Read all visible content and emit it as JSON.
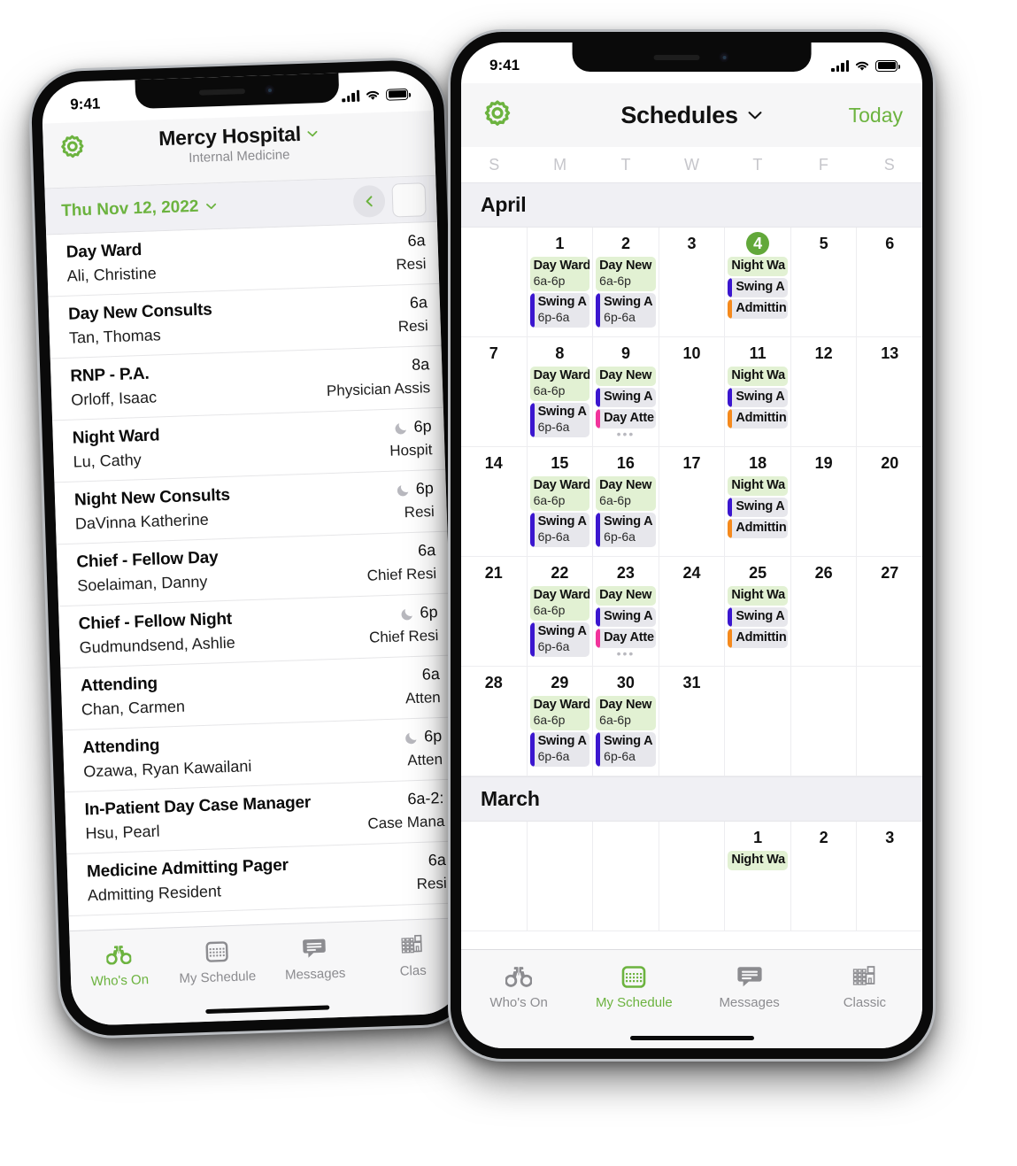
{
  "colors": {
    "accent_green": "#6cb33f",
    "today_badge": "#62a83a",
    "chip_green_bg": "#e2f1d3",
    "chip_grey_bg": "#e7e7ec",
    "bar_indigo": "#3b16cf",
    "bar_orange": "#f58a1d",
    "bar_pink": "#f2339b"
  },
  "phone_left": {
    "status": {
      "time": "9:41",
      "signal_icon": "cellular-bars-icon",
      "wifi_icon": "wifi-icon",
      "battery_icon": "battery-icon"
    },
    "nav": {
      "gear_icon": "gear-icon",
      "title": "Mercy Hospital",
      "title_chevron_icon": "chevron-down-icon",
      "subtitle": "Internal Medicine"
    },
    "datebar": {
      "date": "Thu Nov 12, 2022",
      "chevron_icon": "chevron-down-icon",
      "prev_icon": "chevron-left-icon"
    },
    "rows": [
      {
        "assignment": "Day Ward",
        "person": "Ali, Christine",
        "time": "6a",
        "role": "Resi",
        "night": false
      },
      {
        "assignment": "Day New Consults",
        "person": "Tan, Thomas",
        "time": "6a",
        "role": "Resi",
        "night": false
      },
      {
        "assignment": "RNP - P.A.",
        "person": "Orloff, Isaac",
        "time": "8a",
        "role": "Physician Assis",
        "night": false
      },
      {
        "assignment": "Night Ward",
        "person": "Lu, Cathy",
        "time": "6p",
        "role": "Hospit",
        "night": true
      },
      {
        "assignment": "Night New Consults",
        "person": "DaVinna Katherine",
        "time": "6p",
        "role": "Resi",
        "night": true
      },
      {
        "assignment": "Chief - Fellow Day",
        "person": "Soelaiman, Danny",
        "time": "6a",
        "role": "Chief Resi",
        "night": false
      },
      {
        "assignment": "Chief - Fellow Night",
        "person": "Gudmundsend, Ashlie",
        "time": "6p",
        "role": "Chief Resi",
        "night": true
      },
      {
        "assignment": "Attending",
        "person": "Chan, Carmen",
        "time": "6a",
        "role": "Atten",
        "night": false
      },
      {
        "assignment": "Attending",
        "person": "Ozawa, Ryan Kawailani",
        "time": "6p",
        "role": "Atten",
        "night": true
      },
      {
        "assignment": "In-Patient Day Case Manager",
        "person": "Hsu, Pearl",
        "time": "6a-2:",
        "role": "Case Mana",
        "night": false
      },
      {
        "assignment": "Medicine Admitting Pager",
        "person": "Admitting Resident",
        "time": "6a",
        "role": "Resi",
        "night": false
      }
    ],
    "tabs": [
      {
        "label": "Who's On",
        "icon": "binoculars-icon",
        "active": true
      },
      {
        "label": "My Schedule",
        "icon": "calendar-icon",
        "active": false
      },
      {
        "label": "Messages",
        "icon": "message-icon",
        "active": false
      },
      {
        "label": "Clas",
        "icon": "classic-grid-icon",
        "active": false
      }
    ]
  },
  "phone_right": {
    "status": {
      "time": "9:41",
      "signal_icon": "cellular-bars-icon",
      "wifi_icon": "wifi-icon",
      "battery_icon": "battery-icon"
    },
    "nav": {
      "gear_icon": "gear-icon",
      "title": "Schedules",
      "title_chevron_icon": "chevron-down-icon",
      "today_label": "Today"
    },
    "weekday_headers": [
      "S",
      "M",
      "T",
      "W",
      "T",
      "F",
      "S"
    ],
    "months": [
      {
        "name": "April",
        "weeks": [
          [
            {
              "day": ""
            },
            {
              "day": "1",
              "chips": [
                {
                  "title": "Day Ward",
                  "time": "6a-6p",
                  "style": "green"
                },
                {
                  "title": "Swing A",
                  "time": "6p-6a",
                  "style": "grey",
                  "bar": "#3b16cf"
                }
              ]
            },
            {
              "day": "2",
              "chips": [
                {
                  "title": "Day New",
                  "time": "6a-6p",
                  "style": "green"
                },
                {
                  "title": "Swing A",
                  "time": "6p-6a",
                  "style": "grey",
                  "bar": "#3b16cf"
                }
              ]
            },
            {
              "day": "3"
            },
            {
              "day": "4",
              "today": true,
              "chips": [
                {
                  "title": "Night Wa",
                  "time": "",
                  "style": "green"
                },
                {
                  "title": "Swing A",
                  "time": "",
                  "style": "grey",
                  "bar": "#3b16cf"
                },
                {
                  "title": "Admittin",
                  "time": "",
                  "style": "grey",
                  "bar": "#f58a1d"
                }
              ]
            },
            {
              "day": "5"
            },
            {
              "day": "6"
            }
          ],
          [
            {
              "day": "7"
            },
            {
              "day": "8",
              "chips": [
                {
                  "title": "Day Ward",
                  "time": "6a-6p",
                  "style": "green"
                },
                {
                  "title": "Swing A",
                  "time": "6p-6a",
                  "style": "grey",
                  "bar": "#3b16cf"
                }
              ]
            },
            {
              "day": "9",
              "overflow": true,
              "chips": [
                {
                  "title": "Day New",
                  "time": "",
                  "style": "green"
                },
                {
                  "title": "Swing A",
                  "time": "",
                  "style": "grey",
                  "bar": "#3b16cf"
                },
                {
                  "title": "Day Atte",
                  "time": "",
                  "style": "grey",
                  "bar": "#f2339b"
                }
              ]
            },
            {
              "day": "10"
            },
            {
              "day": "11",
              "chips": [
                {
                  "title": "Night Wa",
                  "time": "",
                  "style": "green"
                },
                {
                  "title": "Swing A",
                  "time": "",
                  "style": "grey",
                  "bar": "#3b16cf"
                },
                {
                  "title": "Admittin",
                  "time": "",
                  "style": "grey",
                  "bar": "#f58a1d"
                }
              ]
            },
            {
              "day": "12"
            },
            {
              "day": "13"
            }
          ],
          [
            {
              "day": "14"
            },
            {
              "day": "15",
              "chips": [
                {
                  "title": "Day Ward",
                  "time": "6a-6p",
                  "style": "green"
                },
                {
                  "title": "Swing A",
                  "time": "6p-6a",
                  "style": "grey",
                  "bar": "#3b16cf"
                }
              ]
            },
            {
              "day": "16",
              "chips": [
                {
                  "title": "Day New",
                  "time": "6a-6p",
                  "style": "green"
                },
                {
                  "title": "Swing A",
                  "time": "6p-6a",
                  "style": "grey",
                  "bar": "#3b16cf"
                }
              ]
            },
            {
              "day": "17"
            },
            {
              "day": "18",
              "chips": [
                {
                  "title": "Night Wa",
                  "time": "",
                  "style": "green"
                },
                {
                  "title": "Swing A",
                  "time": "",
                  "style": "grey",
                  "bar": "#3b16cf"
                },
                {
                  "title": "Admittin",
                  "time": "",
                  "style": "grey",
                  "bar": "#f58a1d"
                }
              ]
            },
            {
              "day": "19"
            },
            {
              "day": "20"
            }
          ],
          [
            {
              "day": "21"
            },
            {
              "day": "22",
              "chips": [
                {
                  "title": "Day Ward",
                  "time": "6a-6p",
                  "style": "green"
                },
                {
                  "title": "Swing A",
                  "time": "6p-6a",
                  "style": "grey",
                  "bar": "#3b16cf"
                }
              ]
            },
            {
              "day": "23",
              "overflow": true,
              "chips": [
                {
                  "title": "Day New",
                  "time": "",
                  "style": "green"
                },
                {
                  "title": "Swing A",
                  "time": "",
                  "style": "grey",
                  "bar": "#3b16cf"
                },
                {
                  "title": "Day Atte",
                  "time": "",
                  "style": "grey",
                  "bar": "#f2339b"
                }
              ]
            },
            {
              "day": "24"
            },
            {
              "day": "25",
              "chips": [
                {
                  "title": "Night Wa",
                  "time": "",
                  "style": "green"
                },
                {
                  "title": "Swing A",
                  "time": "",
                  "style": "grey",
                  "bar": "#3b16cf"
                },
                {
                  "title": "Admittin",
                  "time": "",
                  "style": "grey",
                  "bar": "#f58a1d"
                }
              ]
            },
            {
              "day": "26"
            },
            {
              "day": "27"
            }
          ],
          [
            {
              "day": "28"
            },
            {
              "day": "29",
              "chips": [
                {
                  "title": "Day Ward",
                  "time": "6a-6p",
                  "style": "green"
                },
                {
                  "title": "Swing A",
                  "time": "6p-6a",
                  "style": "grey",
                  "bar": "#3b16cf"
                }
              ]
            },
            {
              "day": "30",
              "chips": [
                {
                  "title": "Day New",
                  "time": "6a-6p",
                  "style": "green"
                },
                {
                  "title": "Swing A",
                  "time": "6p-6a",
                  "style": "grey",
                  "bar": "#3b16cf"
                }
              ]
            },
            {
              "day": "31"
            },
            {
              "day": ""
            },
            {
              "day": ""
            },
            {
              "day": ""
            }
          ]
        ]
      },
      {
        "name": "March",
        "weeks": [
          [
            {
              "day": ""
            },
            {
              "day": ""
            },
            {
              "day": ""
            },
            {
              "day": ""
            },
            {
              "day": "1",
              "chips": [
                {
                  "title": "Night Wa",
                  "time": "",
                  "style": "green"
                }
              ]
            },
            {
              "day": "2"
            },
            {
              "day": "3"
            }
          ]
        ]
      }
    ],
    "tabs": [
      {
        "label": "Who's On",
        "icon": "binoculars-icon",
        "active": false
      },
      {
        "label": "My Schedule",
        "icon": "calendar-icon",
        "active": true
      },
      {
        "label": "Messages",
        "icon": "message-icon",
        "active": false
      },
      {
        "label": "Classic",
        "icon": "classic-grid-icon",
        "active": false
      }
    ]
  }
}
